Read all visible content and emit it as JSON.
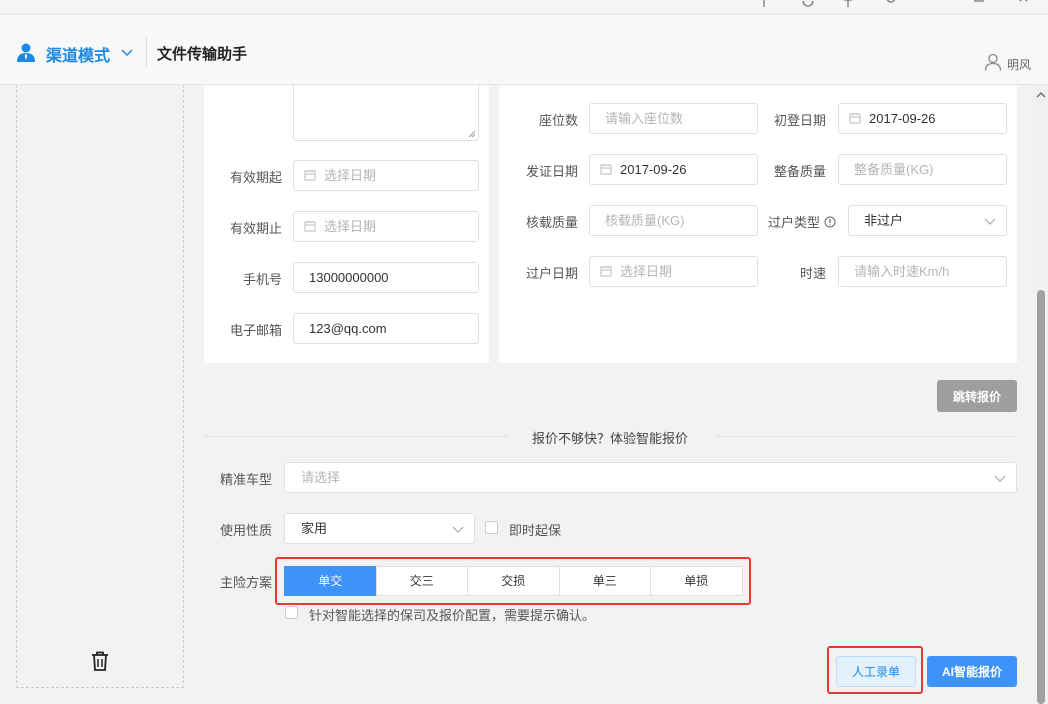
{
  "header": {
    "brand": "渠道模式",
    "title": "文件传输助手",
    "user": "明风"
  },
  "left_form": {
    "valid_from_label": "有效期起",
    "valid_from_placeholder": "选择日期",
    "valid_to_label": "有效期止",
    "valid_to_placeholder": "选择日期",
    "phone_label": "手机号",
    "phone_value": "13000000000",
    "email_label": "电子邮箱",
    "email_value": "123@qq.com"
  },
  "right_form": {
    "seats_label": "座位数",
    "seats_placeholder": "请输入座位数",
    "first_reg_label": "初登日期",
    "first_reg_value": "2017-09-26",
    "issue_date_label": "发证日期",
    "issue_date_value": "2017-09-26",
    "curb_weight_label": "整备质量",
    "curb_weight_placeholder": "整备质量(KG)",
    "rated_weight_label": "核载质量",
    "rated_weight_placeholder": "核载质量(KG)",
    "transfer_type_label": "过户类型",
    "transfer_type_value": "非过户",
    "transfer_date_label": "过户日期",
    "transfer_date_placeholder": "选择日期",
    "speed_label": "时速",
    "speed_placeholder": "请输入时速Km/h"
  },
  "jump_button": "跳转报价",
  "divider_text": "报价不够快？体验智能报价",
  "smart": {
    "model_label": "精准车型",
    "model_placeholder": "请选择",
    "usage_label": "使用性质",
    "usage_value": "家用",
    "instant_label": "即时起保",
    "plan_label": "主险方案",
    "plans": [
      "单交",
      "交三",
      "交损",
      "单三",
      "单损"
    ],
    "selected_plan": "单交",
    "confirm_text": "针对智能选择的保司及报价配置，需要提示确认。"
  },
  "buttons": {
    "manual": "人工录单",
    "ai": "AI智能报价"
  },
  "colors": {
    "accent": "#3d93f7",
    "brand": "#1e88e5",
    "highlight": "#e53935"
  }
}
